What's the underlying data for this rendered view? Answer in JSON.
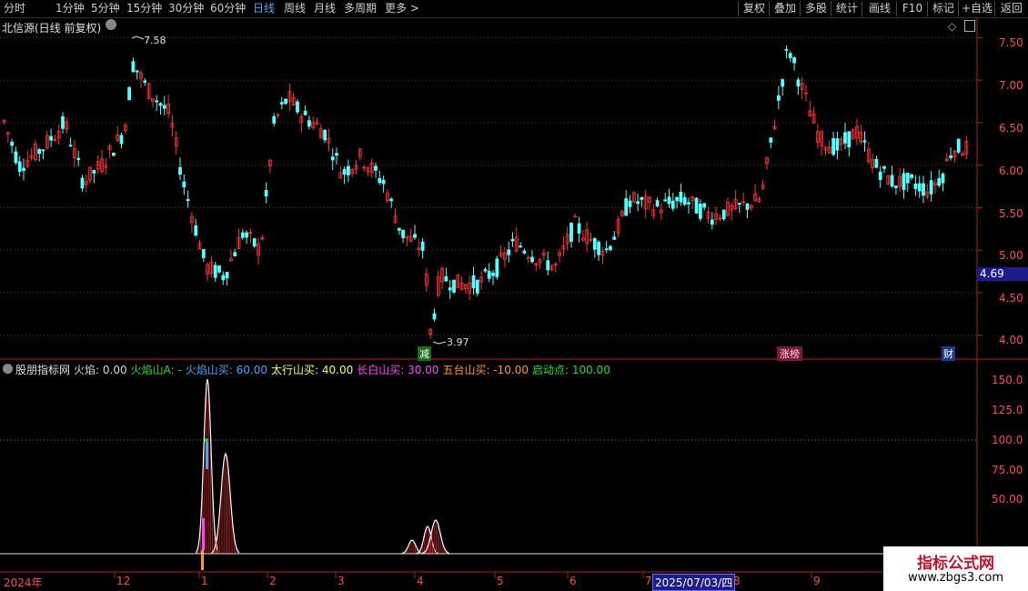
{
  "toolbar": {
    "periods": [
      "分时",
      "1分钟",
      "5分钟",
      "15分钟",
      "30分钟",
      "60分钟",
      "日线",
      "周线",
      "月线",
      "多周期",
      "更多 >"
    ],
    "active_period": "日线",
    "right_buttons": [
      "复权",
      "叠加",
      "多股",
      "统计",
      "画线",
      "F10",
      "标记",
      "+自选",
      "返回"
    ]
  },
  "main_chart": {
    "title": "北信源(日线 前复权)",
    "price_axis_labels": [
      "7.50",
      "7.00",
      "6.50",
      "6.00",
      "5.50",
      "5.00",
      "4.50",
      "4.00"
    ],
    "current_price": "4.69",
    "high_marker": "7.58",
    "low_marker": "3.97",
    "badges": {
      "jian": "减",
      "zhangbang": "涨榜",
      "cai": "财"
    }
  },
  "indicator": {
    "name": "股朋指标网",
    "legend": [
      {
        "text": "火焰: 0.00",
        "color": "#d8d8d8"
      },
      {
        "text": "火焰山A: -",
        "color": "#22dd22"
      },
      {
        "text": "火焰山买: 60.00",
        "color": "#3aa8ff"
      },
      {
        "text": "太行山买: 40.00",
        "color": "#ffff44"
      },
      {
        "text": "长白山买: 30.00",
        "color": "#ff44ff"
      },
      {
        "text": "五台山买: -10.00",
        "color": "#ff9a22"
      },
      {
        "text": "启动点: 100.00",
        "color": "#22dd22"
      }
    ],
    "axis_labels": [
      "150.0",
      "125.0",
      "100.0",
      "75.00",
      "50.00"
    ]
  },
  "time_axis": {
    "labels": [
      "2024年",
      "12",
      "1",
      "2",
      "3",
      "4",
      "5",
      "6",
      "7",
      "8",
      "9"
    ],
    "cursor_date": "2025/07/03/四"
  },
  "watermark": {
    "line1": "指标公式网",
    "line2": "www.zbgs3.com"
  },
  "colors": {
    "up": "#ff3333",
    "down": "#54ffff",
    "grid": "#8b1a1a",
    "axis": "#b02020",
    "active_tab": "#4aa8ff"
  }
}
